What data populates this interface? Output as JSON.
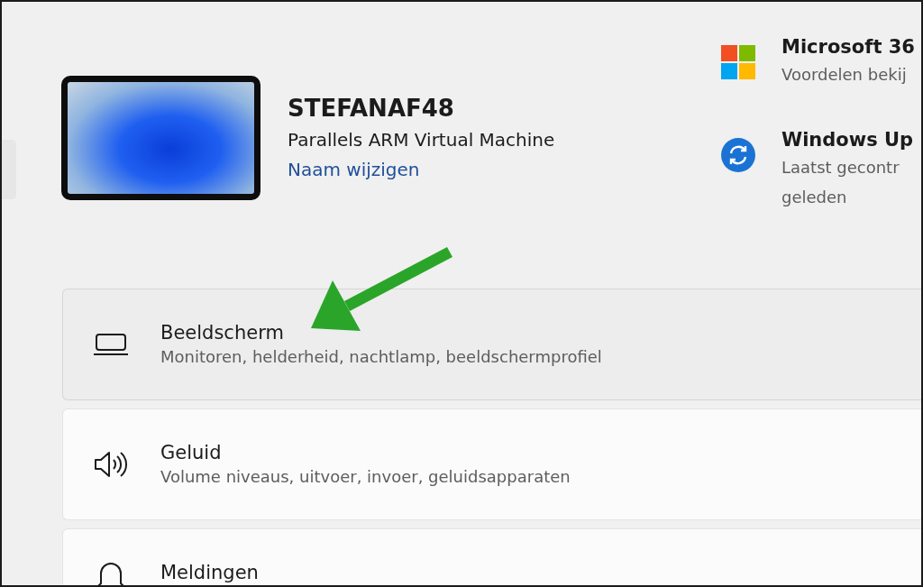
{
  "device": {
    "name": "STEFANAF48",
    "model": "Parallels ARM Virtual Machine",
    "rename_link": "Naam wijzigen"
  },
  "quick_links": [
    {
      "kind": "microsoft365",
      "title": "Microsoft 36",
      "subtitle_lines": [
        "Voordelen bekij"
      ]
    },
    {
      "kind": "update",
      "title": "Windows Up",
      "subtitle_lines": [
        "Laatst gecontr",
        "geleden"
      ]
    }
  ],
  "settings": [
    {
      "kind": "display",
      "title": "Beeldscherm",
      "subtitle": "Monitoren, helderheid, nachtlamp, beeldschermprofiel",
      "selected": true
    },
    {
      "kind": "sound",
      "title": "Geluid",
      "subtitle": "Volume niveaus, uitvoer, invoer, geluidsapparaten",
      "selected": false
    },
    {
      "kind": "notifications",
      "title": "Meldingen",
      "selected": false
    }
  ]
}
